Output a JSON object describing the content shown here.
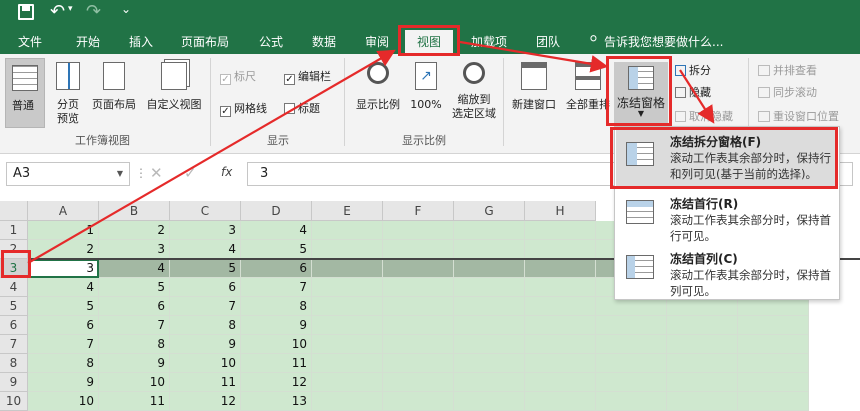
{
  "qat": {
    "undo_label": "↶",
    "redo_label": "↷",
    "more_label": "⌄"
  },
  "tabs": [
    {
      "label": "文件"
    },
    {
      "label": "开始"
    },
    {
      "label": "插入"
    },
    {
      "label": "页面布局"
    },
    {
      "label": "公式"
    },
    {
      "label": "数据"
    },
    {
      "label": "审阅"
    },
    {
      "label": "视图"
    },
    {
      "label": "加载项"
    },
    {
      "label": "团队"
    }
  ],
  "tellme": "告诉我您想要做什么...",
  "ribbon": {
    "workbook_views": {
      "group": "工作簿视图",
      "normal": "普通",
      "page_break": [
        "分页",
        "预览"
      ],
      "page_layout": "页面布局",
      "custom": "自定义视图"
    },
    "show": {
      "group": "显示",
      "ruler": "标尺",
      "formula_bar": "编辑栏",
      "gridlines": "网格线",
      "headings": "标题"
    },
    "zoom": {
      "group": "显示比例",
      "zoom": "显示比例",
      "zoom100": "100%",
      "zoom_sel": [
        "缩放到",
        "选定区域"
      ]
    },
    "window": {
      "new_window": "新建窗口",
      "arrange_all": "全部重排",
      "freeze": "冻结窗格",
      "split": "拆分",
      "hide": "隐藏",
      "unhide": "取消隐藏",
      "side_by_side": "并排查看",
      "sync_scroll": "同步滚动",
      "reset_pos": "重设窗口位置"
    }
  },
  "formula": {
    "name_box": "A3",
    "fx": "fx",
    "value": "3"
  },
  "columns": [
    "A",
    "B",
    "C",
    "D",
    "E",
    "F",
    "G",
    "H"
  ],
  "rows": [
    {
      "n": "1",
      "v": [
        "1",
        "2",
        "3",
        "4"
      ]
    },
    {
      "n": "2",
      "v": [
        "2",
        "3",
        "4",
        "5"
      ]
    },
    {
      "n": "3",
      "v": [
        "3",
        "4",
        "5",
        "6"
      ]
    },
    {
      "n": "4",
      "v": [
        "4",
        "5",
        "6",
        "7"
      ]
    },
    {
      "n": "5",
      "v": [
        "5",
        "6",
        "7",
        "8"
      ]
    },
    {
      "n": "6",
      "v": [
        "6",
        "7",
        "8",
        "9"
      ]
    },
    {
      "n": "7",
      "v": [
        "7",
        "8",
        "9",
        "10"
      ]
    },
    {
      "n": "8",
      "v": [
        "8",
        "9",
        "10",
        "11"
      ]
    },
    {
      "n": "9",
      "v": [
        "9",
        "10",
        "11",
        "12"
      ]
    },
    {
      "n": "10",
      "v": [
        "10",
        "11",
        "12",
        "13"
      ]
    }
  ],
  "freeze_menu": [
    {
      "title": "冻结拆分窗格(F)",
      "desc": "滚动工作表其余部分时，保持行和列可见(基于当前的选择)。"
    },
    {
      "title": "冻结首行(R)",
      "desc": "滚动工作表其余部分时，保持首行可见。"
    },
    {
      "title": "冻结首列(C)",
      "desc": "滚动工作表其余部分时，保持首列可见。"
    }
  ],
  "colors": {
    "excel_green": "#217346",
    "selected_fill": "#a3b8a3",
    "cell_fill": "#cfe8cf",
    "highlight_red": "#e52a2a"
  }
}
